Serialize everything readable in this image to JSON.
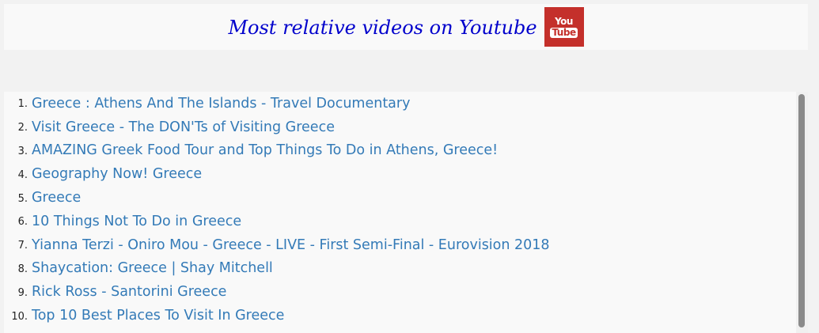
{
  "header": {
    "title": "Most relative videos on Youtube",
    "logo_you": "You",
    "logo_tube": "Tube"
  },
  "colors": {
    "title": "#0000cc",
    "link": "#337ab7",
    "youtube_red": "#c4302b",
    "page_bg": "#f2f2f2",
    "panel_bg": "#f9f9f9"
  },
  "videos": [
    {
      "number": "1.",
      "title": "Greece : Athens And The Islands - Travel Documentary"
    },
    {
      "number": "2.",
      "title": "Visit Greece - The DON'Ts of Visiting Greece"
    },
    {
      "number": "3.",
      "title": "AMAZING Greek Food Tour and Top Things To Do in Athens, Greece!"
    },
    {
      "number": "4.",
      "title": "Geography Now! Greece"
    },
    {
      "number": "5.",
      "title": "Greece"
    },
    {
      "number": "6.",
      "title": "10 Things Not To Do in Greece"
    },
    {
      "number": "7.",
      "title": "Yianna Terzi - Oniro Mou - Greece - LIVE - First Semi-Final - Eurovision 2018"
    },
    {
      "number": "8.",
      "title": "Shaycation: Greece | Shay Mitchell"
    },
    {
      "number": "9.",
      "title": "Rick Ross - Santorini Greece"
    },
    {
      "number": "10.",
      "title": "Top 10 Best Places To Visit In Greece"
    }
  ]
}
